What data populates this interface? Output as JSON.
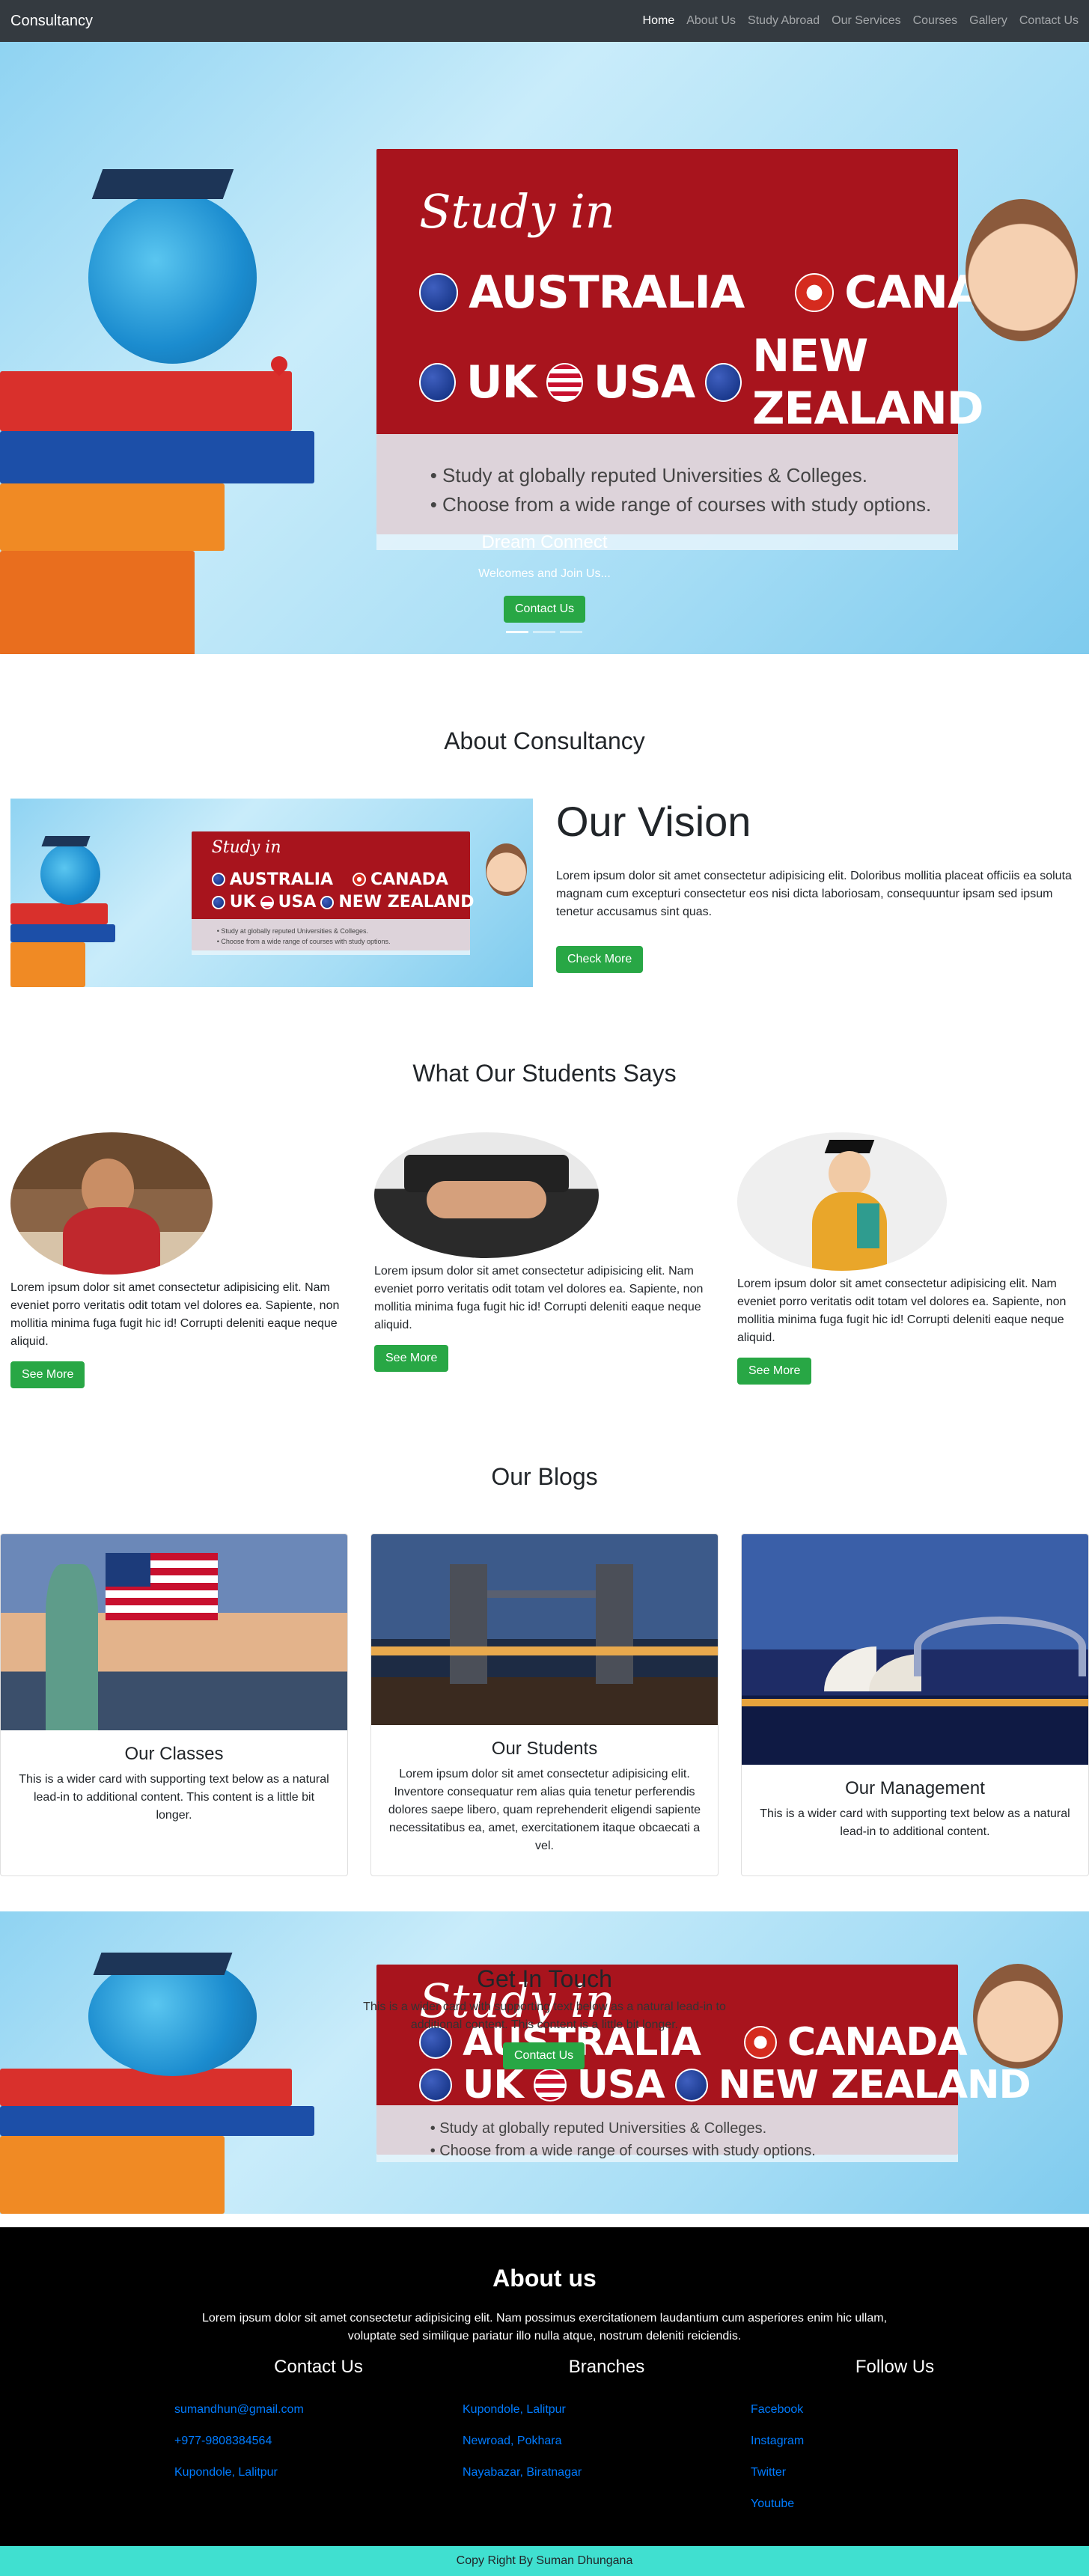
{
  "navbar": {
    "brand": "Consultancy",
    "links": [
      "Home",
      "About Us",
      "Study Abroad",
      "Our Services",
      "Courses",
      "Gallery",
      "Contact Us"
    ]
  },
  "banner_graphic": {
    "study_in": "Study in",
    "countries_row1": [
      "AUSTRALIA",
      "CANADA"
    ],
    "countries_row2": [
      "UK",
      "USA",
      "NEW ZEALAND"
    ],
    "bullets": [
      "• Study at globally reputed Universities & Colleges.",
      "• Choose from a wide range of courses with study options."
    ]
  },
  "hero": {
    "title": "Dream Connect",
    "subtitle": "Welcomes and Join Us...",
    "button": "Contact Us",
    "active_slide": 1,
    "slide_count": 3
  },
  "about": {
    "title": "About Consultancy",
    "vision_title": "Our Vision",
    "vision_text": "Lorem ipsum dolor sit amet consectetur adipisicing elit. Doloribus mollitia placeat officiis ea soluta magnam cum excepturi consectetur eos nisi dicta laboriosam, consequuntur ipsam sed ipsum tenetur accusamus sint quas.",
    "button": "Check More"
  },
  "students": {
    "title": "What Our Students Says",
    "items": [
      {
        "text": "Lorem ipsum dolor sit amet consectetur adipisicing elit. Nam eveniet porro veritatis odit totam vel dolores ea. Sapiente, non mollitia minima fuga fugit hic id! Corrupti deleniti eaque neque aliquid.",
        "button": "See More"
      },
      {
        "text": "Lorem ipsum dolor sit amet consectetur adipisicing elit. Nam eveniet porro veritatis odit totam vel dolores ea. Sapiente, non mollitia minima fuga fugit hic id! Corrupti deleniti eaque neque aliquid.",
        "button": "See More"
      },
      {
        "text": "Lorem ipsum dolor sit amet consectetur adipisicing elit. Nam eveniet porro veritatis odit totam vel dolores ea. Sapiente, non mollitia minima fuga fugit hic id! Corrupti deleniti eaque neque aliquid.",
        "button": "See More"
      }
    ]
  },
  "blogs": {
    "title": "Our Blogs",
    "cards": [
      {
        "title": "Our Classes",
        "text": "This is a wider card with supporting text below as a natural lead-in to additional content. This content is a little bit longer."
      },
      {
        "title": "Our Students",
        "text": "Lorem ipsum dolor sit amet consectetur adipisicing elit. Inventore consequatur rem alias quia tenetur perferendis dolores saepe libero, quam reprehenderit eligendi sapiente necessitatibus ea, amet, exercitationem itaque obcaecati a vel."
      },
      {
        "title": "Our Management",
        "text": "This is a wider card with supporting text below as a natural lead-in to additional content."
      }
    ]
  },
  "touch": {
    "title": "Get In Touch",
    "text": "This is a wider card with supporting text below as a natural lead-in to additional content. This content is a little bit longer.",
    "button": "Contact Us"
  },
  "footer": {
    "title": "About us",
    "text": "Lorem ipsum dolor sit amet consectetur adipisicing elit. Nam possimus exercitationem laudantium cum asperiores enim hic ullam, voluptate sed similique pariatur illo nulla atque, nostrum deleniti reiciendis.",
    "contact": {
      "title": "Contact Us",
      "items": [
        "sumandhun@gmail.com",
        "+977-9808384564",
        "Kupondole, Lalitpur"
      ]
    },
    "branches": {
      "title": "Branches",
      "items": [
        "Kupondole, Lalitpur",
        "Newroad, Pokhara",
        "Nayabazar, Biratnagar"
      ]
    },
    "follow": {
      "title": "Follow Us",
      "items": [
        "Facebook",
        "Instagram",
        "Twitter",
        "Youtube"
      ]
    },
    "copyright": "Copy Right By Suman Dhungana"
  }
}
